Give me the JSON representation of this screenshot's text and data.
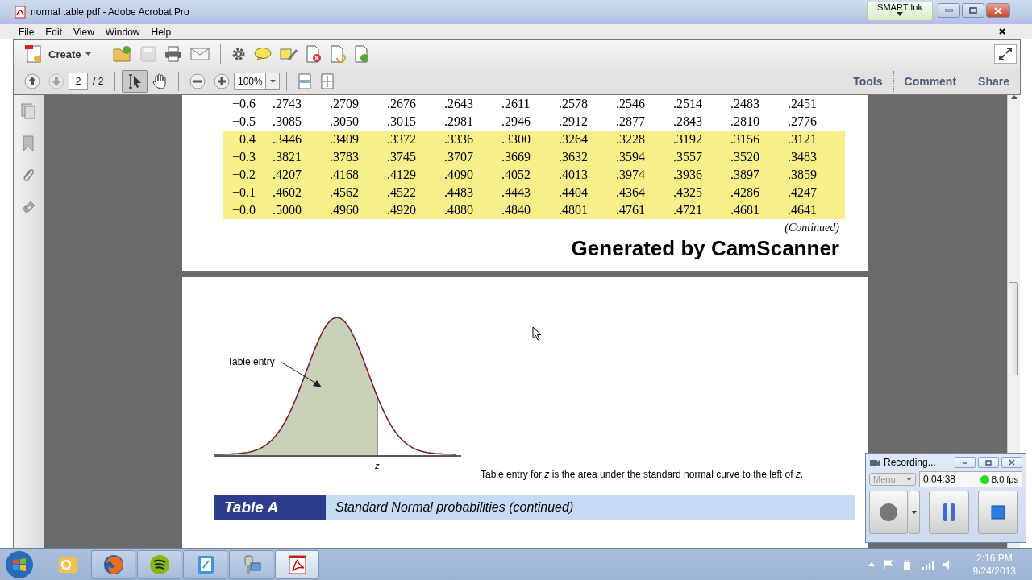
{
  "window": {
    "title": "normal table.pdf - Adobe Acrobat Pro"
  },
  "smart_ink": {
    "label": "SMART Ink"
  },
  "menu": [
    "File",
    "Edit",
    "View",
    "Window",
    "Help"
  ],
  "toolbar": {
    "create": "Create",
    "page_current": "2",
    "page_total": "/ 2",
    "zoom": "100%",
    "save_disabled": true,
    "page_down_disabled": true,
    "tools": [
      {
        "kind": "select",
        "selected": true
      },
      {
        "kind": "hand",
        "selected": false
      }
    ]
  },
  "panes": [
    {
      "label": "Tools"
    },
    {
      "label": "Comment"
    },
    {
      "label": "Share"
    }
  ],
  "document": {
    "table_rows": [
      {
        "z": "−0.6",
        "values": [
          ".2743",
          ".2709",
          ".2676",
          ".2643",
          ".2611",
          ".2578",
          ".2546",
          ".2514",
          ".2483",
          ".2451"
        ],
        "highlighted": false
      },
      {
        "z": "−0.5",
        "values": [
          ".3085",
          ".3050",
          ".3015",
          ".2981",
          ".2946",
          ".2912",
          ".2877",
          ".2843",
          ".2810",
          ".2776"
        ],
        "highlighted": false
      },
      {
        "z": "−0.4",
        "values": [
          ".3446",
          ".3409",
          ".3372",
          ".3336",
          ".3300",
          ".3264",
          ".3228",
          ".3192",
          ".3156",
          ".3121"
        ],
        "highlighted": true
      },
      {
        "z": "−0.3",
        "values": [
          ".3821",
          ".3783",
          ".3745",
          ".3707",
          ".3669",
          ".3632",
          ".3594",
          ".3557",
          ".3520",
          ".3483"
        ],
        "highlighted": true
      },
      {
        "z": "−0.2",
        "values": [
          ".4207",
          ".4168",
          ".4129",
          ".4090",
          ".4052",
          ".4013",
          ".3974",
          ".3936",
          ".3897",
          ".3859"
        ],
        "highlighted": true
      },
      {
        "z": "−0.1",
        "values": [
          ".4602",
          ".4562",
          ".4522",
          ".4483",
          ".4443",
          ".4404",
          ".4364",
          ".4325",
          ".4286",
          ".4247"
        ],
        "highlighted": true
      },
      {
        "z": "−0.0",
        "values": [
          ".5000",
          ".4960",
          ".4920",
          ".4880",
          ".4840",
          ".4801",
          ".4761",
          ".4721",
          ".4681",
          ".4641"
        ],
        "highlighted": true
      }
    ],
    "continued": "(Continued)",
    "scanner_note": "Generated by CamScanner",
    "figure": {
      "label": "Table entry",
      "axis_label": "z"
    },
    "caption": "Table entry for *z* is the area under the standard normal curve to the left of *z*.",
    "table_banner": {
      "label": "Table A",
      "title": "Standard Normal probabilities (continued)"
    }
  },
  "recorder": {
    "title": "Recording...",
    "menu": {
      "label": "Menu",
      "disabled": true
    },
    "time": "0:04:38",
    "fps": "8.0 fps"
  },
  "taskbar": {
    "apps": [
      {
        "kind": "outlook",
        "selected": false
      },
      {
        "kind": "firefox",
        "selected": false
      },
      {
        "kind": "spotify",
        "selected": false
      },
      {
        "kind": "notes",
        "selected": false
      },
      {
        "kind": "camera",
        "selected": false
      },
      {
        "kind": "acrobat",
        "selected": true
      }
    ],
    "time": "2:16 PM",
    "date": "9/24/2013"
  }
}
